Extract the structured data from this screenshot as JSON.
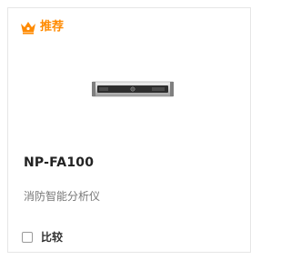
{
  "card": {
    "badge": {
      "icon": "crown-icon",
      "label": "推荐",
      "color": "#ff8a00"
    },
    "product": {
      "image": "rack-device-image",
      "model": "NP-FA100",
      "description": "消防智能分析仪"
    },
    "compare": {
      "label": "比较",
      "checked": false
    }
  }
}
